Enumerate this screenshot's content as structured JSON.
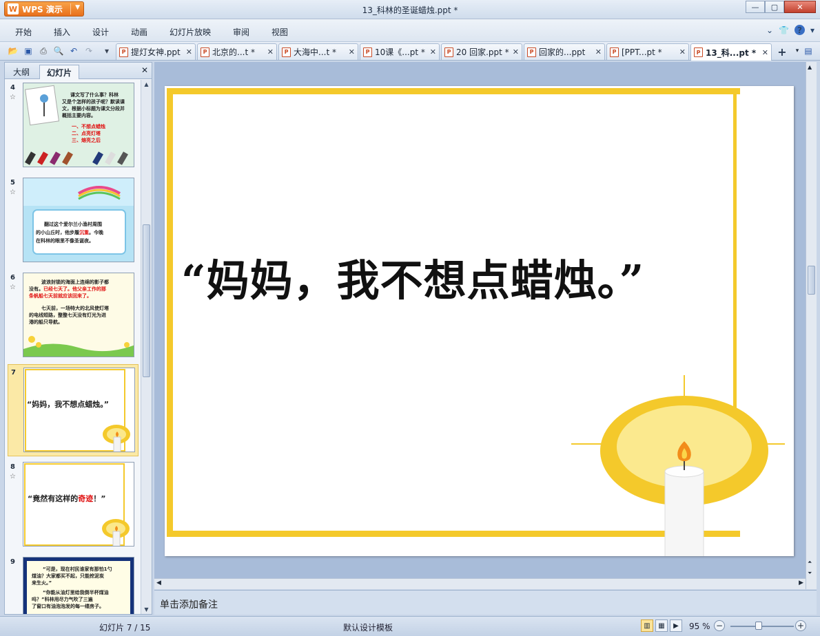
{
  "app": {
    "brand": "WPS 演示",
    "logo_letter": "W",
    "window_title": "13_科林的圣诞蜡烛.ppt *",
    "controls": {
      "minimize": "—",
      "maximize": "▢",
      "close": "✕"
    }
  },
  "menu": {
    "items": [
      "开始",
      "插入",
      "设计",
      "动画",
      "幻灯片放映",
      "审阅",
      "视图"
    ]
  },
  "doc_tabs": [
    {
      "label": "提灯女神.ppt",
      "active": false
    },
    {
      "label": "北京的...t *",
      "active": false
    },
    {
      "label": "大海中...t *",
      "active": false
    },
    {
      "label": "10课《...pt *",
      "active": false
    },
    {
      "label": "20 回家.ppt *",
      "active": false
    },
    {
      "label": "回家的...ppt",
      "active": false
    },
    {
      "label": "[PPT...pt *",
      "active": false
    },
    {
      "label": "13_科...pt *",
      "active": true
    }
  ],
  "left_pane": {
    "tabs": [
      "大纲",
      "幻灯片"
    ],
    "active_tab": "幻灯片",
    "thumbnails": [
      {
        "num": "4",
        "lines": [
          "课文写了什么事？科林",
          "又是个怎样的孩子呢？默读课",
          "文，根据小标题为课文分段并",
          "概括主要内容。"
        ],
        "red_lines": [
          "一、不想点蜡烛",
          "二、点亮灯塔",
          "三、熔亮之后"
        ]
      },
      {
        "num": "5",
        "lines": [
          "翻过这个爱尔兰小渔村周围",
          "的小山丘时，他步履",
          "在科林的眼里不像圣诞夜。"
        ],
        "red_word": "沉重",
        "tail": "。今晚"
      },
      {
        "num": "6",
        "lines": [
          "波浪封锁的海面上连绵的影子都",
          "没有。",
          "条帆船七天前就应该回来了。",
          "七天前，一场特大的北风使灯塔",
          "的电线短路，整整七天没有灯光为进",
          "港的船只导航。"
        ],
        "red_words": [
          "已经七天了。他父亲工作的那"
        ]
      },
      {
        "num": "7",
        "text": "“妈妈，我不想点蜡烛。”",
        "selected": true
      },
      {
        "num": "8",
        "text_before": "“竟然有这样的",
        "text_red": "奇迹",
        "text_after": "！”"
      },
      {
        "num": "9",
        "lines": [
          "“可是，现在村民谁家有那怕1勺",
          "煤油？大家都买不起，只能挖泥炭",
          "来生火。”",
          "“你能从油灯里给我倒半杯煤油",
          "吗？”科林用尽力气吹了三遍",
          "了窗口有油泡泡发的每一缕房子。"
        ]
      }
    ]
  },
  "slide": {
    "text": "“妈妈，我不想点蜡烛。”",
    "colors": {
      "frame": "#f4c92b",
      "flame": "#f28c1a"
    }
  },
  "notes_placeholder": "单击添加备注",
  "status": {
    "slide_counter": "幻灯片 7 / 15",
    "template": "默认设计模板",
    "zoom": "95 %"
  }
}
